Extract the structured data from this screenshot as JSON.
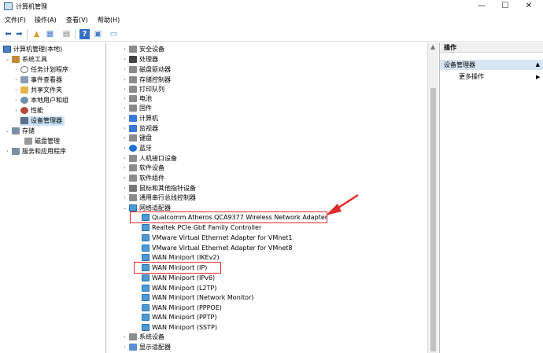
{
  "window": {
    "title": "计算机管理",
    "controls": {
      "minimize": "—",
      "maximize": "☐",
      "close": "✕"
    }
  },
  "menubar": {
    "items": [
      "文件(F)",
      "操作(A)",
      "查看(V)",
      "帮助(H)"
    ]
  },
  "toolbar": {
    "icons": [
      "back-arrow-icon",
      "forward-arrow-icon",
      "up-folder-icon",
      "show-hide-tree-icon",
      "properties-icon",
      "help-icon",
      "view-icon",
      "monitor-icon"
    ]
  },
  "left_tree": {
    "root": "计算机管理(本地)",
    "system_tools": "系统工具",
    "task_scheduler": "任务计划程序",
    "event_viewer": "事件查看器",
    "shared_folders": "共享文件夹",
    "local_users": "本地用户和组",
    "performance": "性能",
    "device_manager": "设备管理器",
    "storage": "存储",
    "disk_management": "磁盘管理",
    "services_apps": "服务和应用程序"
  },
  "device_tree": {
    "categories": [
      "安全设备",
      "处理器",
      "磁盘驱动器",
      "存储控制器",
      "打印队列",
      "电池",
      "固件",
      "计算机",
      "监视器",
      "键盘",
      "蓝牙",
      "人机接口设备",
      "软件设备",
      "软件组件",
      "鼠标和其他指针设备",
      "通用串行总线控制器",
      "网络适配器"
    ],
    "network_adapters": [
      "Qualcomm Atheros QCA9377 Wireless Network Adapter",
      "Realtek PCIe GbE Family Controller",
      "VMware Virtual Ethernet Adapter for VMnet1",
      "VMware Virtual Ethernet Adapter for VMnet8",
      "WAN Miniport (IKEv2)",
      "WAN Miniport (IP)",
      "WAN Miniport (IPv6)",
      "WAN Miniport (L2TP)",
      "WAN Miniport (Network Monitor)",
      "WAN Miniport (PPPOE)",
      "WAN Miniport (PPTP)",
      "WAN Miniport (SSTP)"
    ],
    "after": [
      "系统设备",
      "显示适配器"
    ]
  },
  "actions": {
    "header": "操作",
    "section": "设备管理器",
    "more": "更多操作"
  },
  "colors": {
    "highlight_box": "#e12b2b",
    "selected_row": "#cce4f7",
    "actions_section": "#d7e6f5"
  }
}
